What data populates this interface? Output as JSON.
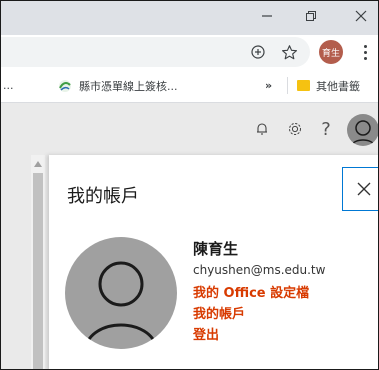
{
  "browser": {
    "omnibox_icons": [
      "add-circle-icon",
      "star-icon"
    ],
    "profile_chip_label": "育生",
    "profile_chip_color": "#b35d4c"
  },
  "bookmarks": {
    "ellipsis": "...",
    "item1_label": "縣市憑單線上簽核...",
    "overflow": "»",
    "other_label": "其他書籤"
  },
  "header": {
    "help_label": "?"
  },
  "panel": {
    "title": "我的帳戶",
    "user_name": "陳育生",
    "user_email": "chyushen@ms.edu.tw",
    "link_office_profile": "我的 Office 設定檔",
    "link_my_account": "我的帳戶",
    "link_sign_out": "登出",
    "link_color": "#d83b01"
  }
}
